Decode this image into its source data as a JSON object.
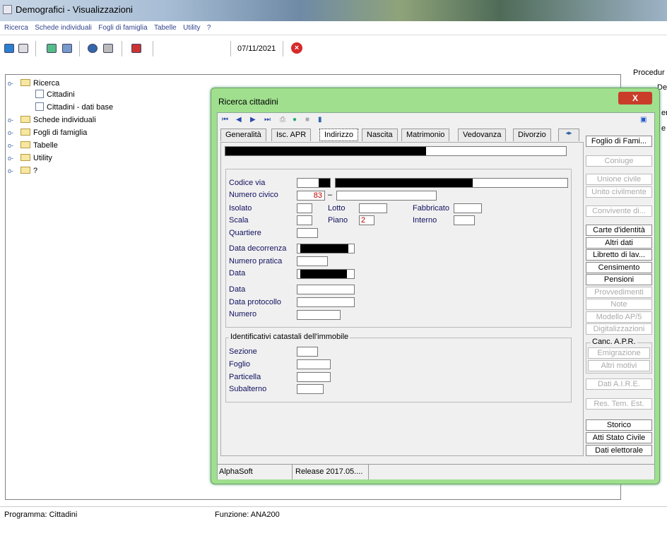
{
  "window": {
    "title": "Demografici - Visualizzazioni"
  },
  "menu": [
    "Ricerca",
    "Schede individuali",
    "Fogli di famiglia",
    "Tabelle",
    "Utility",
    "?"
  ],
  "toolbar": {
    "date": "07/11/2021"
  },
  "tree": {
    "items": [
      "Ricerca",
      "Cittadini",
      "Cittadini - dati base",
      "Schede individuali",
      "Fogli di famiglia",
      "Tabelle",
      "Utility",
      "?"
    ]
  },
  "right_panel": {
    "texts": [
      "Procedur",
      "Demogr",
      "en",
      "e"
    ]
  },
  "status": {
    "program": "Programma: Cittadini",
    "function": "Funzione:  ANA200"
  },
  "dialog": {
    "title": "Ricerca cittadini",
    "close": "X",
    "tabs": [
      "Generalità",
      "Isc. APR",
      "Indirizzo",
      "Nascita",
      "Matrimonio",
      "Vedovanza",
      "Divorzio"
    ],
    "fields": {
      "codice_via": "Codice via",
      "numero_civico": "Numero civico",
      "numero_civico_val": "83",
      "dash": "–",
      "isolato": "Isolato",
      "lotto": "Lotto",
      "fabbricato": "Fabbricato",
      "scala": "Scala",
      "piano": "Piano",
      "piano_val": "2",
      "interno": "Interno",
      "quartiere": "Quartiere",
      "data_decorrenza": "Data decorrenza",
      "numero_pratica": "Numero pratica",
      "data1": "Data",
      "data2": "Data",
      "data_protocollo": "Data protocollo",
      "numero": "Numero"
    },
    "catastali": {
      "title": "Identificativi catastali dell'immobile",
      "sezione": "Sezione",
      "foglio": "Foglio",
      "particella": "Particella",
      "subalterno": "Subalterno"
    },
    "side_buttons": {
      "foglio_fami": "Foglio di Fami...",
      "coniuge": "Coniuge",
      "unione_civile": "Unione civile",
      "unito_civilmente": "Unito civilmente",
      "convivente": "Convivente di...",
      "carte_identita": "Carte d'identità",
      "altri_dati": "Altri dati",
      "libretto": "Libretto di lav...",
      "censimento": "Censimento",
      "pensioni": "Pensioni",
      "provvedimenti": "Provvedimenti",
      "note": "Note",
      "modello": "Modello AP/5",
      "digitalizzazioni": "Digitalizzazioni",
      "canc_apr": "Canc. A.P.R.",
      "emigrazione": "Emigrazione",
      "altri_motivi": "Altri motivi",
      "dati_aire": "Dati A.I.R.E.",
      "res_tem": "Res. Tem. Est.",
      "storico": "Storico",
      "atti_stato": "Atti Stato Civile",
      "dati_elettorale": "Dati elettorale"
    },
    "statusbar": {
      "vendor": "AlphaSoft",
      "release": "Release 2017.05...."
    }
  }
}
